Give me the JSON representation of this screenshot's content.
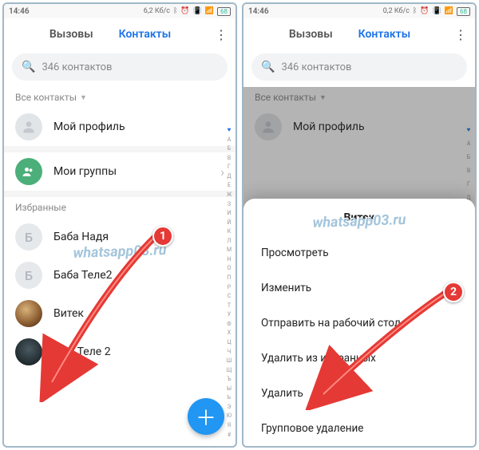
{
  "left": {
    "status": {
      "time": "14:46",
      "net": "6,2 Кб/с"
    },
    "tabs": {
      "calls": "Вызовы",
      "contacts": "Контакты"
    },
    "search": {
      "placeholder": "346 контактов"
    },
    "allContacts": "Все контакты",
    "myProfile": "Мой профиль",
    "myGroups": "Мои группы",
    "favorites": "Избранные",
    "contacts": [
      {
        "label": "Баба Надя",
        "letter": "Б"
      },
      {
        "label": "Баба Теле2",
        "letter": "Б"
      },
      {
        "label": "Витек"
      },
      {
        "label": "Дед Теле 2"
      }
    ],
    "marker": "1",
    "watermark": "whatsapp03.ru",
    "alphaIndex": [
      "♥",
      "А",
      "Б",
      "В",
      "Г",
      "Д",
      "Е",
      "Ж",
      "З",
      "И",
      "Й",
      "К",
      "Л",
      "М",
      "Н",
      "О",
      "П",
      "Р",
      "С",
      "Т",
      "У",
      "Ф",
      "Х",
      "Ц",
      "Ч",
      "Ш",
      "Щ",
      "Ъ",
      "Ы",
      "Ь",
      "Э",
      "Ю",
      "Я",
      "#"
    ]
  },
  "right": {
    "status": {
      "time": "14:46",
      "net": "0,2 Кб/с"
    },
    "tabs": {
      "calls": "Вызовы",
      "contacts": "Контакты"
    },
    "search": {
      "placeholder": "346 контактов"
    },
    "allContacts": "Все контакты",
    "myProfile": "Мой профиль",
    "sheet": {
      "title": "Витек",
      "items": [
        "Просмотреть",
        "Изменить",
        "Отправить на рабочий стол",
        "Удалить из избранных",
        "Удалить",
        "Групповое удаление"
      ]
    },
    "marker": "2",
    "watermark": "whatsapp03.ru",
    "alphaIndex": [
      "♥",
      "А",
      "Б",
      "В",
      "Г",
      "Д",
      "Е"
    ]
  }
}
